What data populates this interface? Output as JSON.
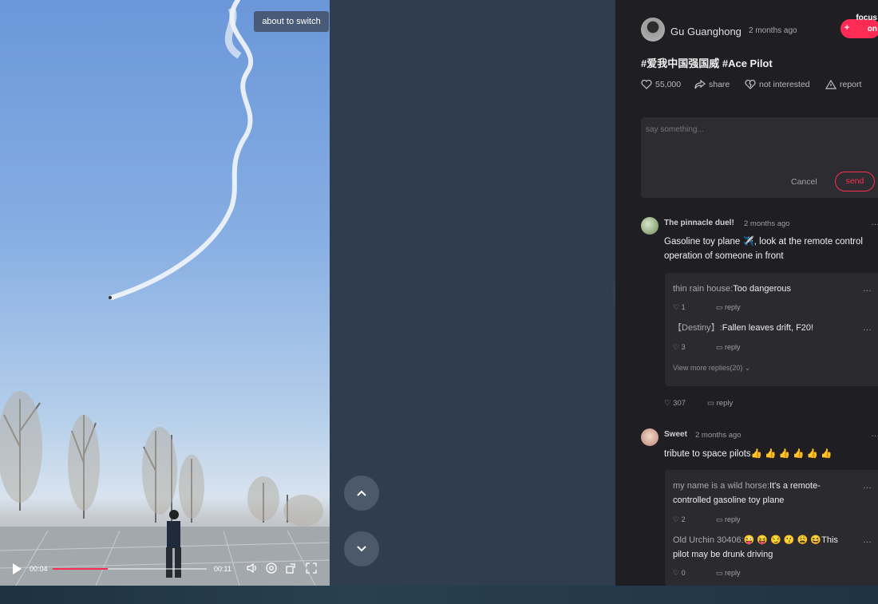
{
  "video": {
    "switch_tip": "about to switch",
    "current_time": "00:04",
    "total_time": "00:11",
    "progress_fraction": 0.36
  },
  "author": {
    "name": "Gu Guanghong",
    "time": "2 months ago",
    "focus_label": "focus on",
    "focus_plus": "+"
  },
  "caption": "#爱我中国强国威 #Ace Pilot",
  "actions": {
    "likes": "55,000",
    "share": "share",
    "not_interested": "not interested",
    "report": "report"
  },
  "comment_box": {
    "placeholder": "say something...",
    "cancel": "Cancel",
    "send": "send"
  },
  "comments": [
    {
      "name": "The pinnacle duel!",
      "time": "2 months ago",
      "text": "Gasoline toy plane ✈️, look at the remote control operation of someone in front",
      "likes": "307",
      "reply": "reply",
      "replies": [
        {
          "name": "thin rain house:",
          "text": "Too dangerous",
          "likes": "1",
          "reply": "reply"
        },
        {
          "name": "【Destiny】:",
          "text": "Fallen leaves drift, F20!",
          "likes": "3",
          "reply": "reply"
        }
      ],
      "view_more": "View more replies(20)"
    },
    {
      "name": "Sweet",
      "time": "2 months ago",
      "text": "tribute to space pilots👍 👍 👍 👍 👍 👍",
      "replies": [
        {
          "name": "my name is a wild horse:",
          "text": "It's a remote-controlled gasoline toy plane",
          "likes": "2",
          "reply": "reply"
        },
        {
          "name": "Old Urchin 30406:",
          "text": "😜 😝 😏 😗 😩 😆This pilot may be drunk driving",
          "likes": "0",
          "reply": "reply"
        }
      ]
    }
  ],
  "colors": {
    "accent": "#fe2c55",
    "panel_bg": "#1f1f23",
    "middle_bg": "#2f3d4f"
  }
}
